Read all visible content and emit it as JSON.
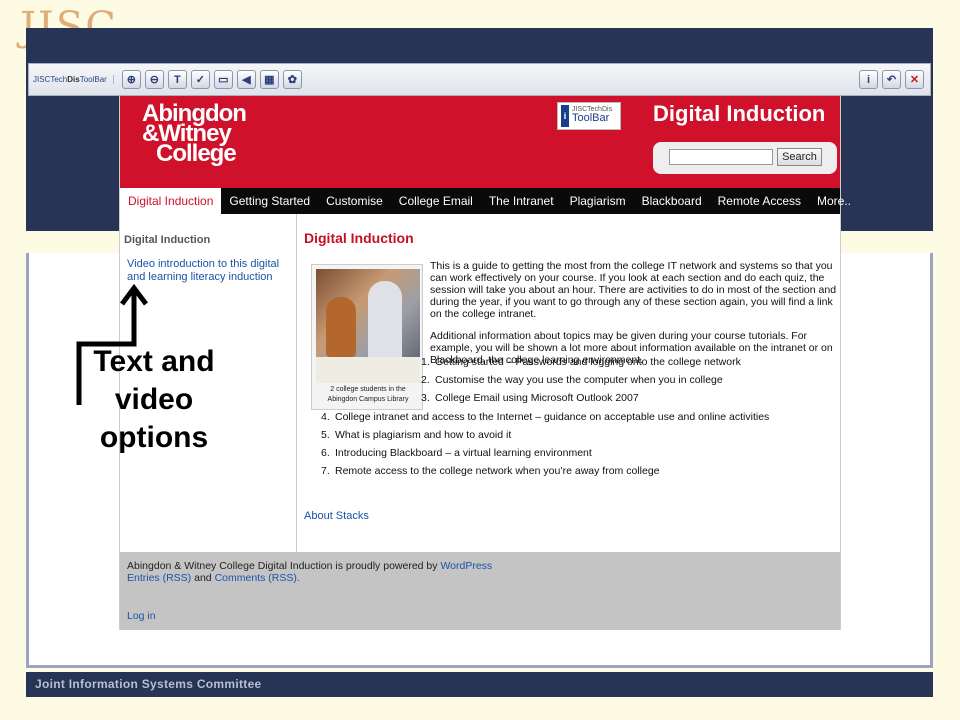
{
  "slide": {
    "logo_text": "JISC",
    "footer_text": "Joint Information Systems Committee",
    "annotation": [
      "Text and",
      "video",
      "options"
    ]
  },
  "toolbar": {
    "brand_prefix": "JISCTech",
    "brand_bold": "Dis",
    "brand_suffix": "ToolBar",
    "buttons": [
      "zoom-in-icon",
      "zoom-out-icon",
      "text-icon",
      "spellcheck-icon",
      "dictionary-icon",
      "speak-icon",
      "calculator-icon",
      "settings-icon"
    ],
    "right_buttons": [
      "info-icon",
      "undo-icon",
      "close-icon"
    ]
  },
  "site": {
    "college": [
      "Abingdon",
      "&Witney",
      "College"
    ],
    "badge_small": "JISCTechDis",
    "badge_big": "ToolBar",
    "title": "Digital Induction",
    "search_value": "",
    "search_button": "Search",
    "nav": [
      "Digital Induction",
      "Getting Started",
      "Customise",
      "College Email",
      "The Intranet",
      "Plagiarism",
      "Blackboard",
      "Remote Access",
      "More.."
    ],
    "sidebar_heading": "Digital Induction",
    "sidebar_link": "Video introduction to this digital and learning literacy induction",
    "main_title": "Digital Induction",
    "caption": "2 college students in the Abingdon Campus Library",
    "para1": "This is a guide to getting the most from the college IT network and systems so that you can work effectively on your course. If you look at each section and do each quiz, the session will take you about an hour. There are activities to do in most of the section and during the year, if you want to go through any of these section again, you will find a link on the college intranet.",
    "para2": "Additional information about topics may be given during your course tutorials. For example, you will be shown a lot more about information available on the intranet or on Blackboard, the college learning environment.",
    "toc": [
      {
        "n": "1.",
        "text": "Getting started – Passwords and logging onto the college network"
      },
      {
        "n": "2.",
        "text": "Customise the way you use the computer when you in college"
      },
      {
        "n": "3.",
        "text": "College Email using Microsoft Outlook 2007"
      },
      {
        "n": "4.",
        "text": "College intranet and access to the Internet – guidance on acceptable use and online activities"
      },
      {
        "n": "5.",
        "text": "What is plagiarism and how to avoid it"
      },
      {
        "n": "6.",
        "text": "Introducing Blackboard – a virtual learning environment"
      },
      {
        "n": "7.",
        "text": "Remote access to the college network when you’re away from college"
      }
    ],
    "about_link": "About Stacks",
    "footer_text": "Abingdon & Witney College Digital Induction is proudly powered by",
    "footer_wp": "WordPress",
    "footer_entries": "Entries (RSS)",
    "footer_and": "and",
    "footer_comments": "Comments (RSS).",
    "login": "Log in"
  },
  "colors": {
    "slide_bar": "#273455",
    "header_red": "#d0112b",
    "link_blue": "#1a53a8"
  }
}
